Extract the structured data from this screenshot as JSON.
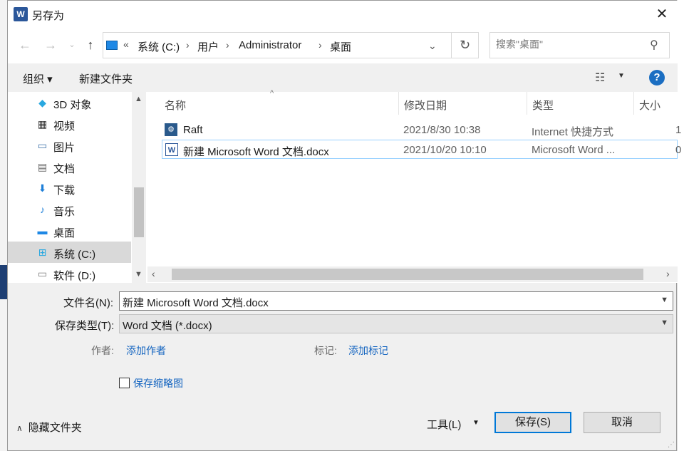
{
  "window": {
    "title": "另存为",
    "app_icon": "word-icon",
    "close_label": "✕"
  },
  "nav": {
    "breadcrumb_overflow": "«",
    "breadcrumbs": [
      "系统 (C:)",
      "用户",
      "Administrator",
      "桌面"
    ],
    "search_placeholder": "搜索\"桌面\""
  },
  "toolbar": {
    "organize_label": "组织 ▾",
    "new_folder_label": "新建文件夹",
    "help_label": "?"
  },
  "sidebar": {
    "items": [
      {
        "label": "3D 对象",
        "icon": "cube-3d-icon"
      },
      {
        "label": "视频",
        "icon": "video-icon"
      },
      {
        "label": "图片",
        "icon": "picture-icon"
      },
      {
        "label": "文档",
        "icon": "document-icon"
      },
      {
        "label": "下载",
        "icon": "download-icon"
      },
      {
        "label": "音乐",
        "icon": "music-icon"
      },
      {
        "label": "桌面",
        "icon": "desktop-icon"
      },
      {
        "label": "系统 (C:)",
        "icon": "drive-windows-icon",
        "selected": true
      },
      {
        "label": "软件 (D:)",
        "icon": "drive-icon"
      }
    ]
  },
  "files": {
    "columns": [
      "名称",
      "修改日期",
      "类型",
      "大小"
    ],
    "rows": [
      {
        "name": "Raft",
        "modified": "2021/8/30 10:38",
        "type": "Internet 快捷方式",
        "size": "1",
        "icon": "shortcut-icon"
      },
      {
        "name": "新建 Microsoft Word 文档.docx",
        "modified": "2021/10/20 10:10",
        "type": "Microsoft Word ...",
        "size": "0",
        "icon": "word-doc-icon",
        "selected": true
      }
    ]
  },
  "form": {
    "filename_label": "文件名(N):",
    "filename_value": "新建 Microsoft Word 文档.docx",
    "filetype_label": "保存类型(T):",
    "filetype_value": "Word 文档 (*.docx)",
    "author_label": "作者:",
    "author_link": "添加作者",
    "tags_label": "标记:",
    "tags_link": "添加标记",
    "thumbnail_label": "保存缩略图",
    "thumbnail_checked": false
  },
  "footer": {
    "hide_folders_label": "隐藏文件夹",
    "tools_label": "工具(L)",
    "save_label": "保存(S)",
    "cancel_label": "取消"
  },
  "colors": {
    "accent": "#0078d7",
    "link": "#1565c0",
    "selection": "#d9d9d9"
  }
}
